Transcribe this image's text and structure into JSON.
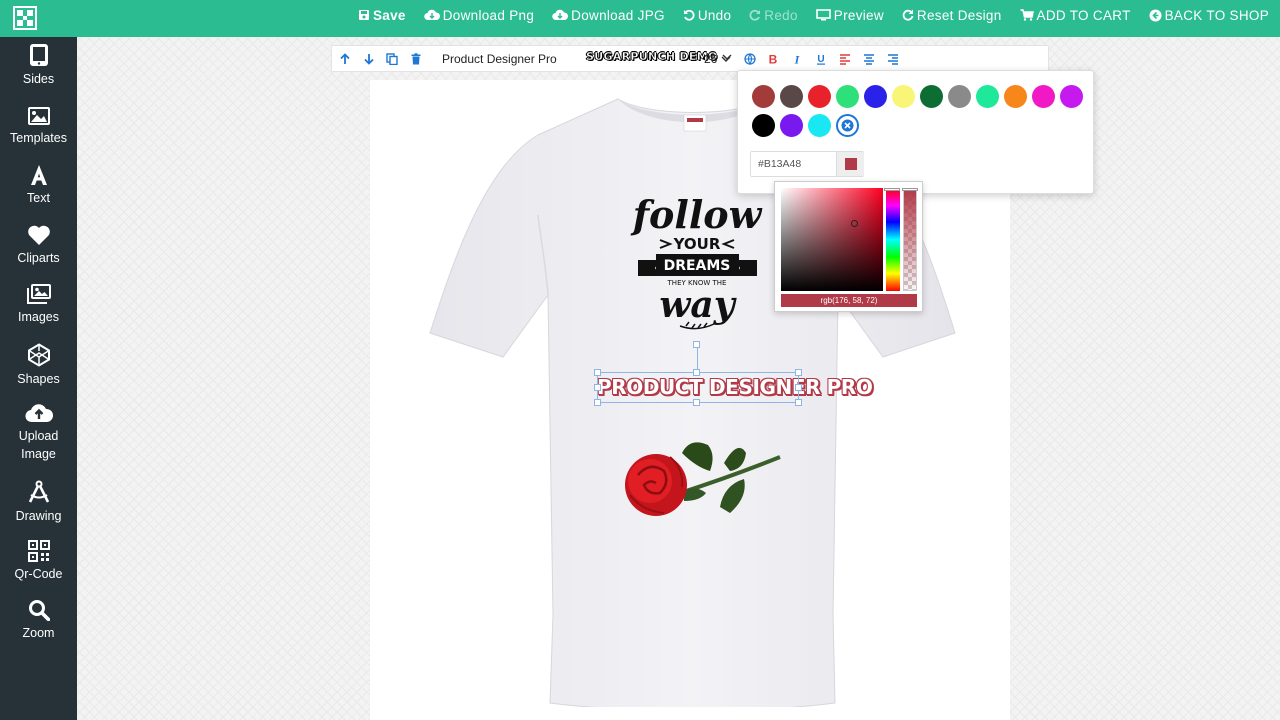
{
  "topbar": {
    "save": "Save",
    "download_png": "Download Png",
    "download_jpg": "Download JPG",
    "undo": "Undo",
    "redo": "Redo",
    "preview": "Preview",
    "reset": "Reset Design",
    "add_to_cart": "ADD TO CART",
    "back_to_shop": "BACK TO SHOP",
    "color": "#2bbd91"
  },
  "sidebar": {
    "items": [
      {
        "label": "Sides",
        "icon": "tablet-icon"
      },
      {
        "label": "Templates",
        "icon": "image-icon"
      },
      {
        "label": "Text",
        "icon": "text-icon"
      },
      {
        "label": "Cliparts",
        "icon": "heart-icon"
      },
      {
        "label": "Images",
        "icon": "images-icon"
      },
      {
        "label": "Shapes",
        "icon": "shapes-icon"
      },
      {
        "label": "Upload Image",
        "icon": "cloud-upload-icon"
      },
      {
        "label": "Drawing",
        "icon": "drawing-compass-icon"
      },
      {
        "label": "Qr-Code",
        "icon": "qr-code-icon"
      },
      {
        "label": "Zoom",
        "icon": "search-icon"
      }
    ],
    "color": "#263238"
  },
  "toolbar": {
    "text_value": "Product Designer Pro",
    "font_name": "SUGARPUNCH DEMO",
    "font_size": "26"
  },
  "design": {
    "text": "PRODUCT DESIGNER PRO",
    "text_color": "#b13a48",
    "graphic_lines": [
      "follow",
      "YOUR",
      "DREAMS",
      "THEY KNOW THE",
      "way"
    ]
  },
  "color_picker": {
    "swatches": [
      "#a33b3b",
      "#5a4848",
      "#e8222a",
      "#2ee07a",
      "#2a22e8",
      "#f8f577",
      "#0d6e34",
      "#8a8a8a",
      "#1ee89a",
      "#f7861b",
      "#f019c5",
      "#c619ef",
      "#000000",
      "#7a19ef",
      "#19e8f2"
    ],
    "hex_value": "#B13A48",
    "rgb_label": "rgb(176, 58, 72)"
  }
}
